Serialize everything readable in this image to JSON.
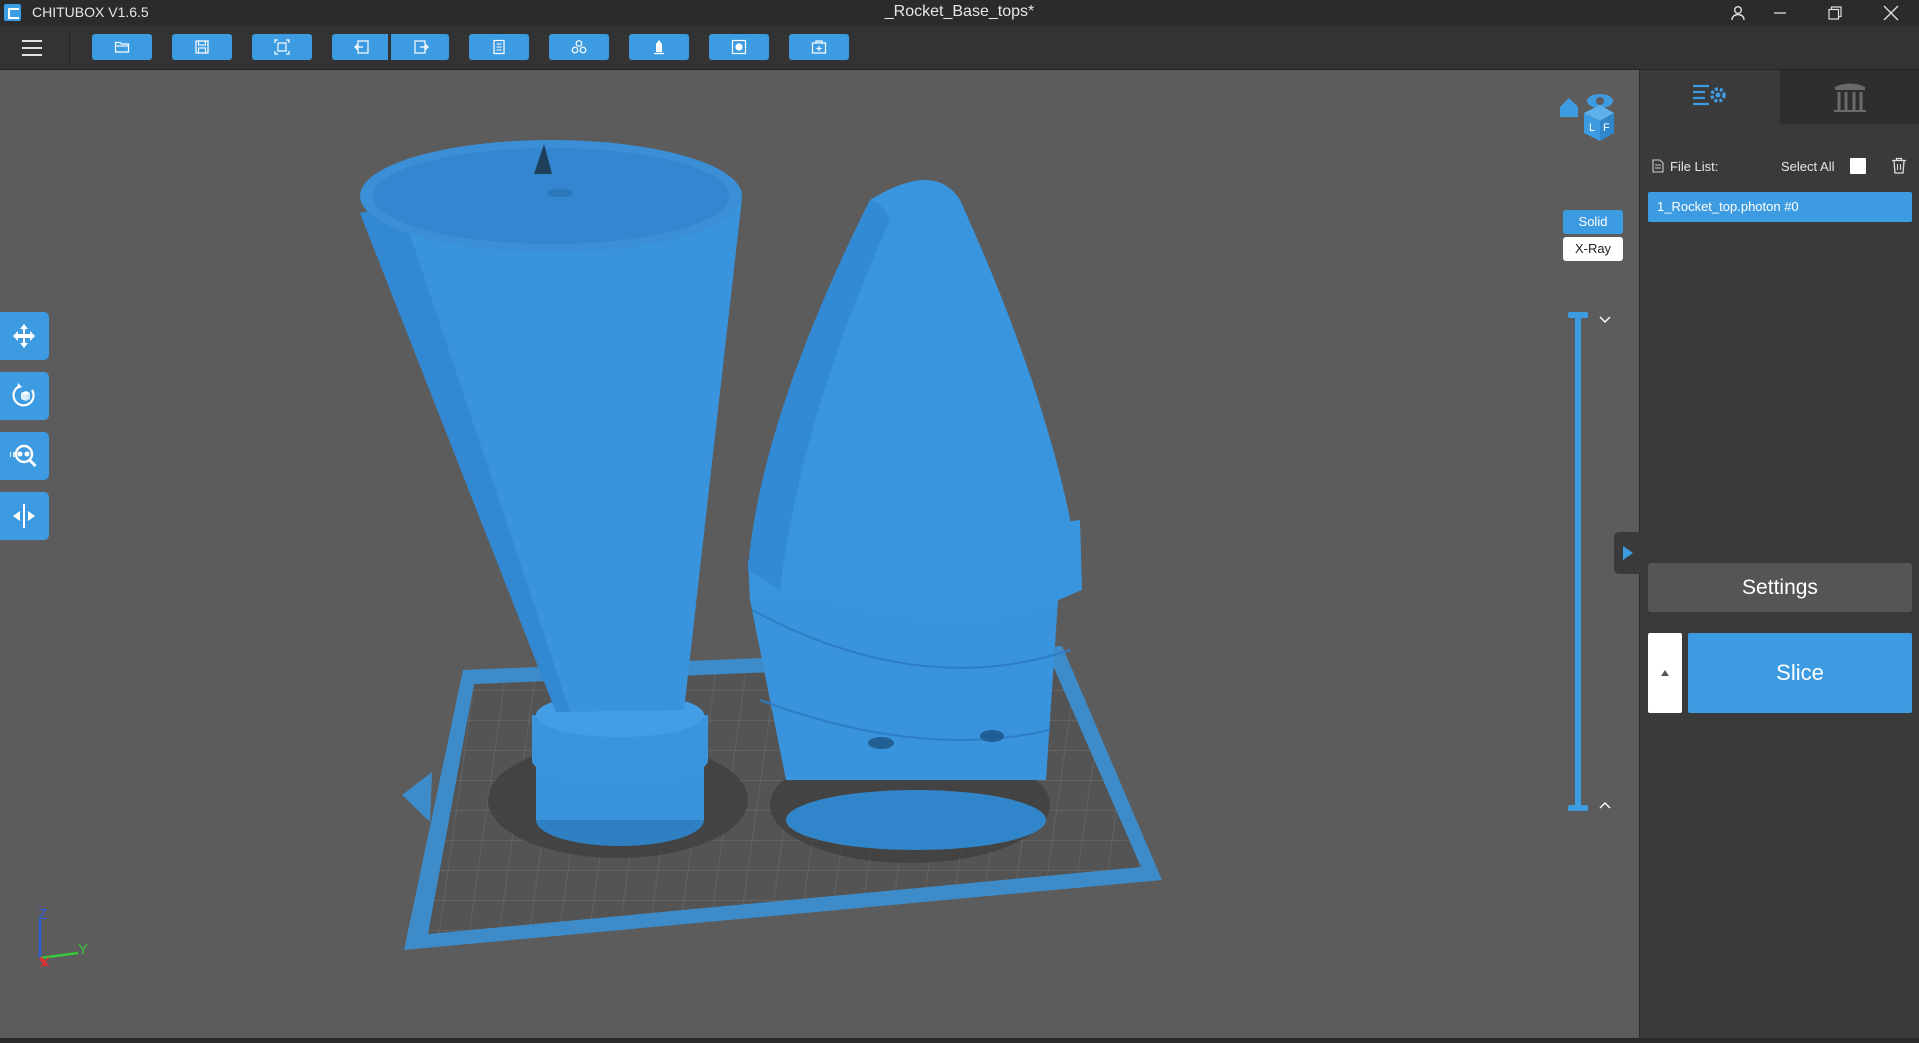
{
  "titlebar": {
    "app_name": "CHITUBOX V1.6.5",
    "document_title": "_Rocket_Base_tops*",
    "user_icon": "user-icon",
    "minimize_icon": "minimize-icon",
    "restore_icon": "restore-icon",
    "close_icon": "close-icon"
  },
  "toolbar": {
    "menu_icon": "hamburger-menu-icon",
    "buttons": [
      {
        "icon": "open-file-icon"
      },
      {
        "icon": "save-icon"
      },
      {
        "icon": "screenshot-icon"
      },
      {
        "icon": "undo-icon"
      },
      {
        "icon": "redo-icon"
      },
      {
        "icon": "document-icon"
      },
      {
        "icon": "arrange-icon"
      },
      {
        "icon": "support-icon"
      },
      {
        "icon": "hollow-icon"
      },
      {
        "icon": "add-box-icon"
      }
    ]
  },
  "viewport": {
    "left_tools": [
      {
        "icon": "move-icon"
      },
      {
        "icon": "rotate-icon"
      },
      {
        "icon": "scale-icon"
      },
      {
        "icon": "mirror-icon"
      }
    ],
    "view_cube_icon": "view-cube-icon",
    "render_modes": {
      "solid": "Solid",
      "xray": "X-Ray"
    },
    "axis": {
      "z": "Z",
      "y": "Y",
      "x": "X"
    },
    "model_color": "#3993dd",
    "plate_color": "#3d8cc9"
  },
  "panel": {
    "tabs": [
      {
        "icon": "model-settings-icon"
      },
      {
        "icon": "supports-icon"
      }
    ],
    "file_list_label": "File List:",
    "select_all_label": "Select All",
    "trash_icon": "trash-icon",
    "files": [
      "1_Rocket_top.photon #0"
    ],
    "settings_label": "Settings",
    "slice_label": "Slice"
  },
  "colors": {
    "accent": "#3d9be1",
    "titlebar_bg": "#2b2b2b",
    "panel_bg": "#3a3a3a",
    "viewport_bg": "#5c5c5c"
  }
}
